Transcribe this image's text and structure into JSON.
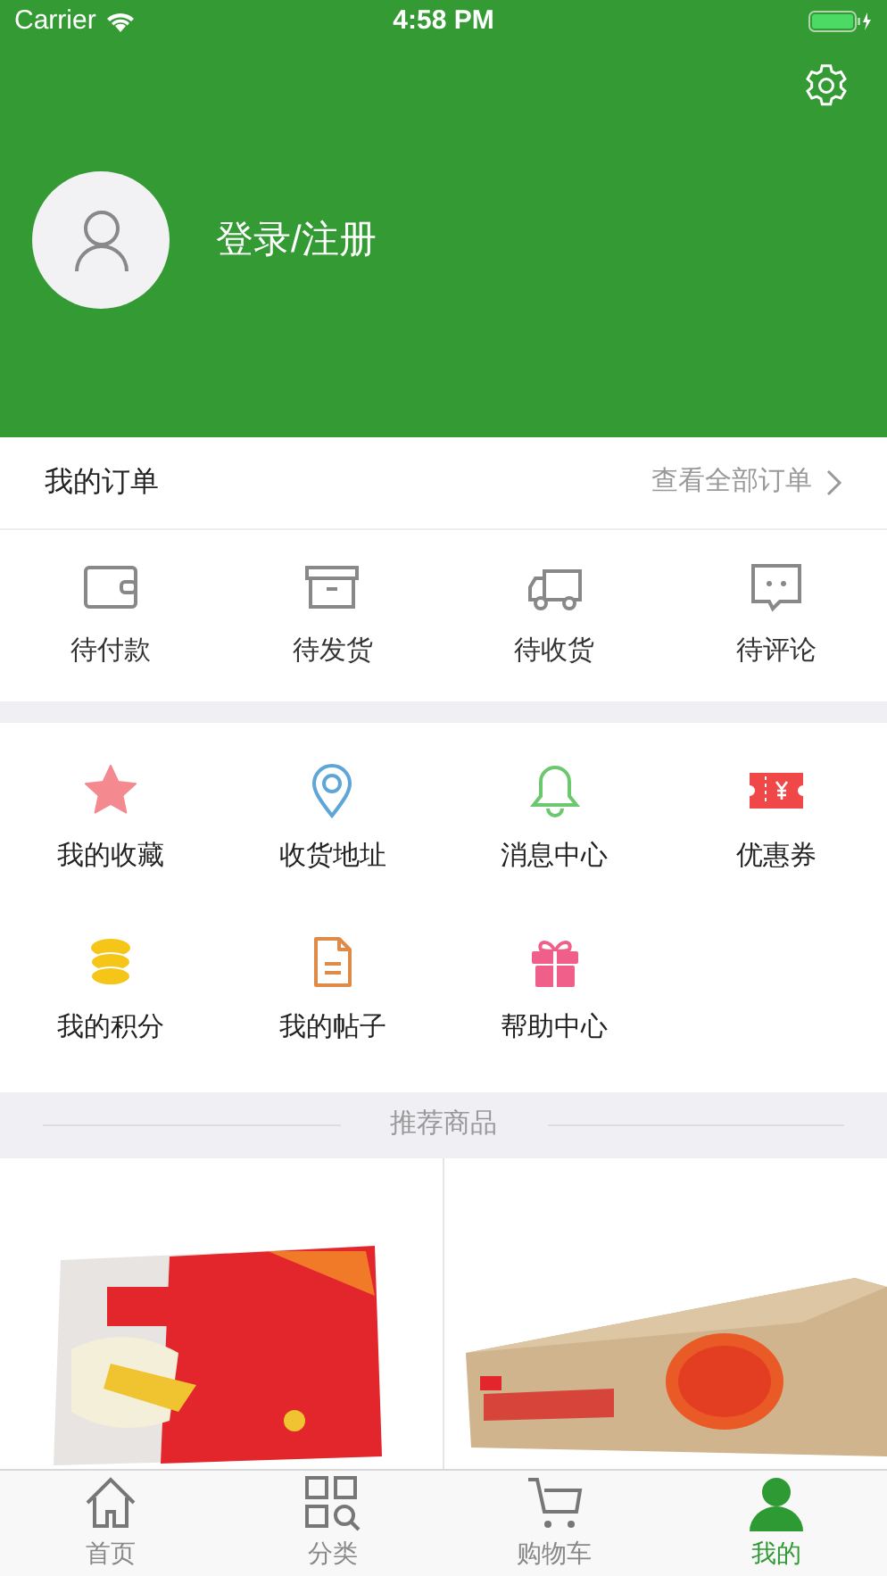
{
  "status_bar": {
    "carrier": "Carrier",
    "time": "4:58 PM"
  },
  "profile": {
    "login_label": "登录/注册"
  },
  "orders": {
    "title": "我的订单",
    "view_all": "查看全部订单",
    "items": [
      {
        "label": "待付款"
      },
      {
        "label": "待发货"
      },
      {
        "label": "待收货"
      },
      {
        "label": "待评论"
      }
    ]
  },
  "services": [
    {
      "label": "我的收藏"
    },
    {
      "label": "收货地址"
    },
    {
      "label": "消息中心"
    },
    {
      "label": "优惠券"
    },
    {
      "label": "我的积分"
    },
    {
      "label": "我的帖子"
    },
    {
      "label": "帮助中心"
    }
  ],
  "recommend": {
    "title": "推荐商品"
  },
  "tab_bar": [
    {
      "label": "首页",
      "selected": false
    },
    {
      "label": "分类",
      "selected": false
    },
    {
      "label": "购物车",
      "selected": false
    },
    {
      "label": "我的",
      "selected": true
    }
  ]
}
